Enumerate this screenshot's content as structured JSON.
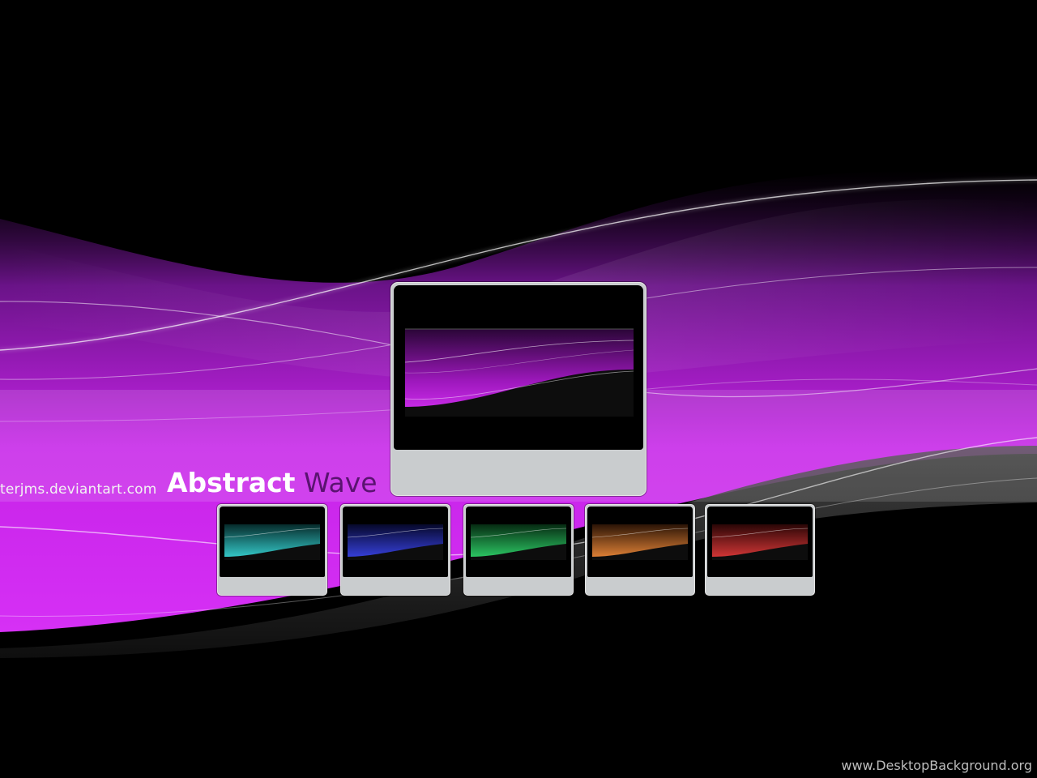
{
  "wallpaper": {
    "credit_text": "terjms.deviantart.com",
    "title_word_1": "Abstract",
    "title_word_2": "Wave",
    "watermark": "www.DesktopBackground.org",
    "accent_color": "#d020f0",
    "title_accent_color": "#5a1370"
  },
  "preview_main": {
    "wave_color": "#c21ae0",
    "icon": "monitor-icon"
  },
  "color_variants": [
    {
      "name": "cyan",
      "color": "#38d6d6"
    },
    {
      "name": "blue",
      "color": "#3a44e8"
    },
    {
      "name": "green",
      "color": "#2fd46a"
    },
    {
      "name": "orange",
      "color": "#ee8a3a"
    },
    {
      "name": "red",
      "color": "#e03a3a"
    }
  ]
}
